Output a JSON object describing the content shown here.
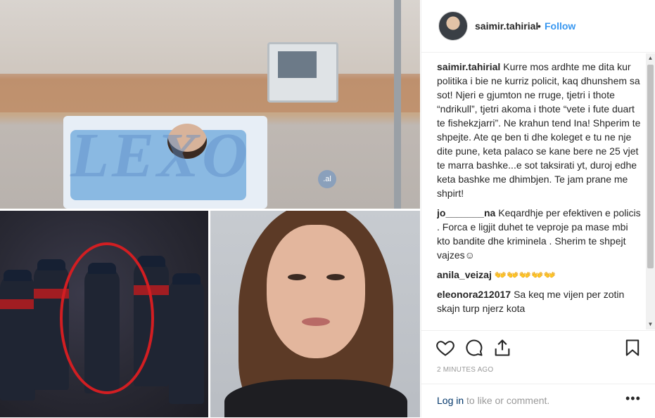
{
  "post": {
    "username": "saimir.tahirial",
    "separator": "•",
    "follow_label": "Follow",
    "watermark": "LEXO",
    "watermark_domain": ".al"
  },
  "comments": [
    {
      "author": "saimir.tahirial",
      "text": "Kurre mos ardhte me dita kur politika i bie ne kurriz policit, kaq dhunshem sa sot! Njeri e gjumton ne rruge, tjetri i thote “ndrikull”, tjetri akoma i thote “vete i fute duart te fishekzjarri”. Ne krahun tend Ina! Shperim te shpejte. Ate qe ben ti dhe koleget e tu ne nje dite pune, keta palaco se kane bere ne 25 vjet te marra bashke...e sot taksirati yt, duroj edhe keta bashke me dhimbjen. Te jam prane me shpirt!"
    },
    {
      "author": "jo_______na",
      "text": "Keqardhje per efektiven e policis . Forca e ligjit duhet te veproje pa mase mbi kto bandite dhe kriminela . Sherim te shpejt vajzes☺"
    },
    {
      "author": "anila_veizaj",
      "text": "👐👐👐👐👐"
    },
    {
      "author": "eleonora212017",
      "text": "Sa keq me vijen per zotin skajn turp njerz kota"
    }
  ],
  "actions": {
    "like_icon": "heart-icon",
    "comment_icon": "comment-icon",
    "share_icon": "share-icon",
    "save_icon": "bookmark-icon"
  },
  "timestamp": "2 MINUTES AGO",
  "footer": {
    "login_link": "Log in",
    "login_suffix": " to like or comment.",
    "more": "•••"
  }
}
